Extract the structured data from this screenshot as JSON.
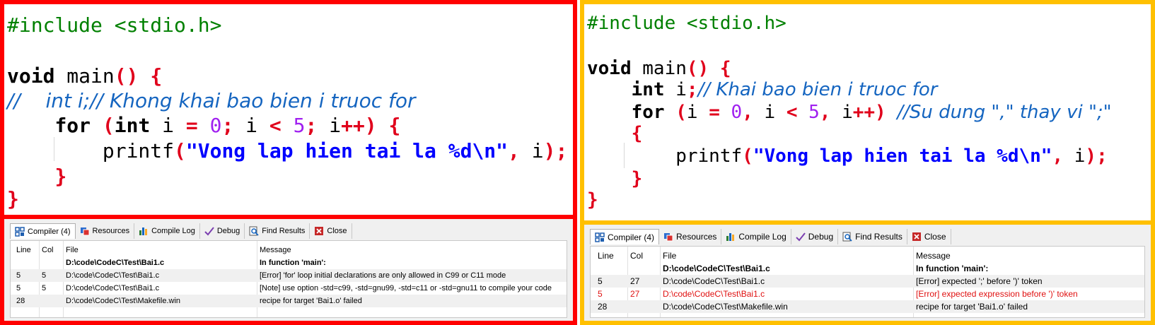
{
  "left_panel": {
    "code_lines": [
      {
        "tokens": [
          {
            "t": "#include <stdio.h>",
            "c": "pp"
          }
        ]
      },
      {
        "tokens": []
      },
      {
        "tokens": [
          {
            "t": "void",
            "c": "kw"
          },
          {
            "t": " main",
            "c": "id"
          },
          {
            "t": "()",
            "c": "red"
          },
          {
            "t": " ",
            "c": "id"
          },
          {
            "t": "{",
            "c": "red"
          }
        ]
      },
      {
        "tokens": [
          {
            "t": "//    int i;// Khong khai bao bien i truoc for",
            "c": "cm"
          }
        ]
      },
      {
        "tokens": [
          {
            "t": "    ",
            "c": "id"
          },
          {
            "t": "for",
            "c": "kw"
          },
          {
            "t": " ",
            "c": "id"
          },
          {
            "t": "(",
            "c": "red"
          },
          {
            "t": "int",
            "c": "kw"
          },
          {
            "t": " i ",
            "c": "id"
          },
          {
            "t": "=",
            "c": "red"
          },
          {
            "t": " ",
            "c": "id"
          },
          {
            "t": "0",
            "c": "num"
          },
          {
            "t": ";",
            "c": "red"
          },
          {
            "t": " i ",
            "c": "id"
          },
          {
            "t": "<",
            "c": "red"
          },
          {
            "t": " ",
            "c": "id"
          },
          {
            "t": "5",
            "c": "num"
          },
          {
            "t": ";",
            "c": "red"
          },
          {
            "t": " i",
            "c": "id"
          },
          {
            "t": "++)",
            "c": "red"
          },
          {
            "t": " ",
            "c": "id"
          },
          {
            "t": "{",
            "c": "red"
          }
        ]
      },
      {
        "tokens": [
          {
            "t": "        printf",
            "c": "id"
          },
          {
            "t": "(",
            "c": "red"
          },
          {
            "t": "\"Vong lap hien tai la %d\\n\"",
            "c": "str"
          },
          {
            "t": ",",
            "c": "red"
          },
          {
            "t": " i",
            "c": "id"
          },
          {
            "t": ");",
            "c": "red"
          }
        ]
      },
      {
        "tokens": [
          {
            "t": "    ",
            "c": "id"
          },
          {
            "t": "}",
            "c": "red"
          }
        ]
      },
      {
        "tokens": [
          {
            "t": "}",
            "c": "red"
          }
        ]
      }
    ],
    "messages": {
      "headers": {
        "line": "Line",
        "col": "Col",
        "file": "File",
        "message": "Message"
      },
      "rows": [
        {
          "line": "",
          "col": "",
          "file": "D:\\code\\CodeC\\Test\\Bai1.c",
          "message": "In function 'main':",
          "bold": true,
          "err": false
        },
        {
          "line": "5",
          "col": "5",
          "file": "D:\\code\\CodeC\\Test\\Bai1.c",
          "message": "[Error] 'for' loop initial declarations are only allowed in C99 or C11 mode",
          "bold": false,
          "err": false
        },
        {
          "line": "5",
          "col": "5",
          "file": "D:\\code\\CodeC\\Test\\Bai1.c",
          "message": "[Note] use option -std=c99, -std=gnu99, -std=c11 or -std=gnu11 to compile your code",
          "bold": false,
          "err": false
        },
        {
          "line": "28",
          "col": "",
          "file": "D:\\code\\CodeC\\Test\\Makefile.win",
          "message": "recipe for target 'Bai1.o' failed",
          "bold": false,
          "err": false
        }
      ]
    }
  },
  "right_panel": {
    "code_lines": [
      {
        "tokens": [
          {
            "t": "#include <stdio.h>",
            "c": "pp"
          }
        ]
      },
      {
        "tokens": []
      },
      {
        "tokens": [
          {
            "t": "void",
            "c": "kw"
          },
          {
            "t": " main",
            "c": "id"
          },
          {
            "t": "()",
            "c": "red"
          },
          {
            "t": " ",
            "c": "id"
          },
          {
            "t": "{",
            "c": "red"
          }
        ]
      },
      {
        "tokens": [
          {
            "t": "    ",
            "c": "id"
          },
          {
            "t": "int",
            "c": "kw"
          },
          {
            "t": " i",
            "c": "id"
          },
          {
            "t": ";",
            "c": "red"
          },
          {
            "t": "// Khai bao bien i truoc for",
            "c": "cm"
          }
        ]
      },
      {
        "tokens": [
          {
            "t": "    ",
            "c": "id"
          },
          {
            "t": "for",
            "c": "kw"
          },
          {
            "t": " ",
            "c": "id"
          },
          {
            "t": "(",
            "c": "red"
          },
          {
            "t": "i ",
            "c": "id"
          },
          {
            "t": "=",
            "c": "red"
          },
          {
            "t": " ",
            "c": "id"
          },
          {
            "t": "0",
            "c": "num"
          },
          {
            "t": ",",
            "c": "red"
          },
          {
            "t": " i ",
            "c": "id"
          },
          {
            "t": "<",
            "c": "red"
          },
          {
            "t": " ",
            "c": "id"
          },
          {
            "t": "5",
            "c": "num"
          },
          {
            "t": ",",
            "c": "red"
          },
          {
            "t": " i",
            "c": "id"
          },
          {
            "t": "++)",
            "c": "red"
          },
          {
            "t": " ",
            "c": "id"
          },
          {
            "t": "//Su dung \",\" thay vi \";\"",
            "c": "cm"
          }
        ]
      },
      {
        "tokens": [
          {
            "t": "    ",
            "c": "id"
          },
          {
            "t": "{",
            "c": "red"
          }
        ]
      },
      {
        "tokens": [
          {
            "t": "        printf",
            "c": "id"
          },
          {
            "t": "(",
            "c": "red"
          },
          {
            "t": "\"Vong lap hien tai la %d\\n\"",
            "c": "str"
          },
          {
            "t": ",",
            "c": "red"
          },
          {
            "t": " i",
            "c": "id"
          },
          {
            "t": ");",
            "c": "red"
          }
        ]
      },
      {
        "tokens": [
          {
            "t": "    ",
            "c": "id"
          },
          {
            "t": "}",
            "c": "red"
          }
        ]
      },
      {
        "tokens": [
          {
            "t": "}",
            "c": "red"
          }
        ]
      }
    ],
    "messages": {
      "headers": {
        "line": "Line",
        "col": "Col",
        "file": "File",
        "message": "Message"
      },
      "rows": [
        {
          "line": "",
          "col": "",
          "file": "D:\\code\\CodeC\\Test\\Bai1.c",
          "message": "In function 'main':",
          "bold": true,
          "err": false
        },
        {
          "line": "5",
          "col": "27",
          "file": "D:\\code\\CodeC\\Test\\Bai1.c",
          "message": "[Error] expected ';' before ')' token",
          "bold": false,
          "err": false
        },
        {
          "line": "5",
          "col": "27",
          "file": "D:\\code\\CodeC\\Test\\Bai1.c",
          "message": "[Error] expected expression before ')' token",
          "bold": false,
          "err": true
        },
        {
          "line": "28",
          "col": "",
          "file": "D:\\code\\CodeC\\Test\\Makefile.win",
          "message": "recipe for target 'Bai1.o' failed",
          "bold": false,
          "err": false
        }
      ]
    }
  },
  "tabs": [
    {
      "label": "Compiler (4)",
      "icon": "compiler-grid-icon",
      "active": true
    },
    {
      "label": "Resources",
      "icon": "resources-icon",
      "active": false
    },
    {
      "label": "Compile Log",
      "icon": "compile-log-chart-icon",
      "active": false
    },
    {
      "label": "Debug",
      "icon": "debug-check-icon",
      "active": false
    },
    {
      "label": "Find Results",
      "icon": "find-results-icon",
      "active": false
    },
    {
      "label": "Close",
      "icon": "close-icon",
      "active": false
    }
  ],
  "colors": {
    "left_frame": "#ff0000",
    "right_frame": "#ffc000",
    "error_text": "#e01010"
  }
}
